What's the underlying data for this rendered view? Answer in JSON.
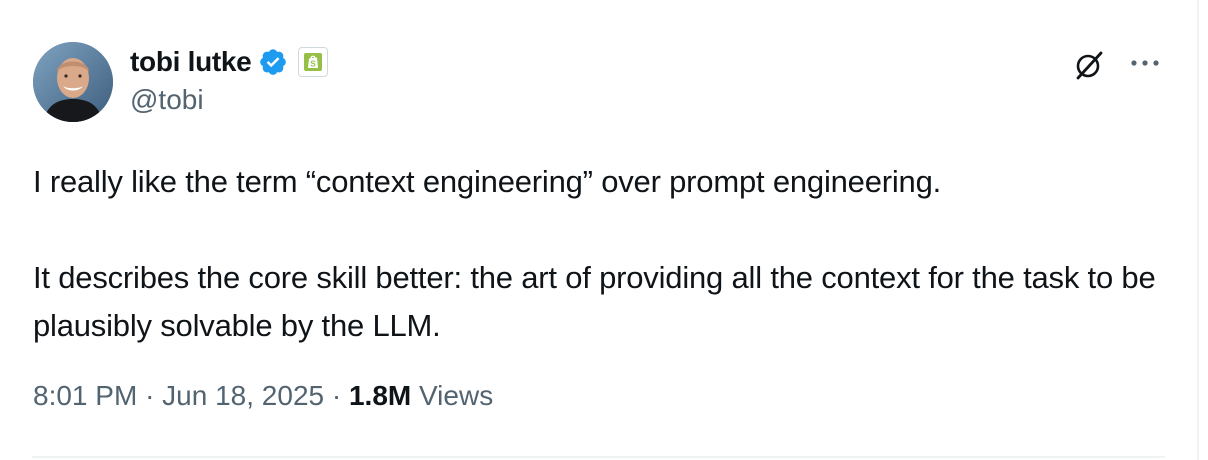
{
  "author": {
    "display_name": "tobi lutke",
    "handle": "@tobi",
    "verified_icon": "verified-badge-icon",
    "affiliate_icon": "shopify-bag-icon"
  },
  "tweet": {
    "paragraphs": [
      "I really like the term “context engineering” over prompt engineering.",
      "It describes the core skill better: the art of providing all the context for the task to be plausibly solvable by the LLM."
    ]
  },
  "meta": {
    "time": "8:01 PM",
    "separator": "·",
    "date": "Jun 18, 2025",
    "views_count": "1.8M",
    "views_label": "Views"
  },
  "actions": {
    "grok_icon": "grok-icon",
    "more_icon": "more-horizontal-icon"
  },
  "colors": {
    "text": "#0f1419",
    "secondary": "#536471",
    "verified": "#1d9bf0",
    "shopify": "#95bf47",
    "divider": "#eff3f4"
  }
}
